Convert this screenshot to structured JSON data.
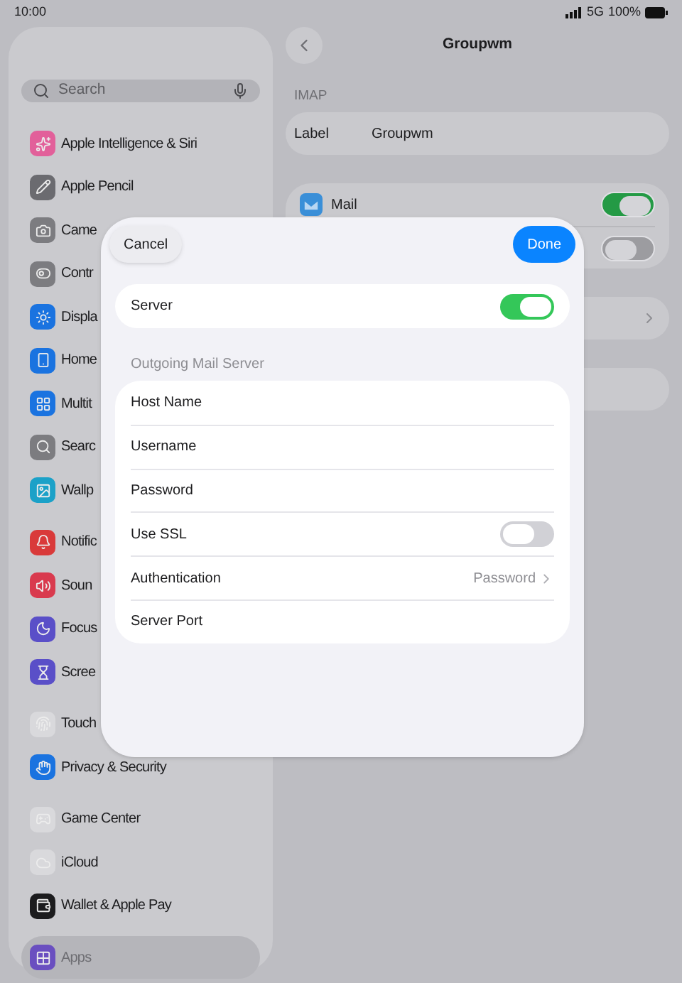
{
  "status_bar": {
    "time": "10:00",
    "network": "5G",
    "battery": "100%"
  },
  "sidebar": {
    "search": {
      "placeholder": "Search"
    },
    "groups": [
      [
        {
          "label": "Apple Intelligence & Siri",
          "color": "#e2609a",
          "selected": false
        },
        {
          "label": "Apple Pencil",
          "color": "#6b6b70",
          "selected": false
        },
        {
          "label": "Came",
          "color": "#7c7c80",
          "selected": false
        },
        {
          "label": "Contr",
          "color": "#7c7c80",
          "selected": false
        },
        {
          "label": "Displa",
          "color": "#1a73e0",
          "selected": false
        },
        {
          "label": "Home",
          "color": "#1a73e0",
          "selected": false
        },
        {
          "label": "Multit",
          "color": "#1a73e0",
          "selected": false
        },
        {
          "label": "Searc",
          "color": "#7c7c80",
          "selected": false
        },
        {
          "label": "Wallp",
          "color": "#1ba1c8",
          "selected": false
        }
      ],
      [
        {
          "label": "Notific",
          "color": "#d93a3a",
          "selected": false
        },
        {
          "label": "Soun",
          "color": "#d93a4e",
          "selected": false
        },
        {
          "label": "Focus",
          "color": "#5a4fc8",
          "selected": false
        },
        {
          "label": "Scree",
          "color": "#5a4fc8",
          "selected": false
        }
      ],
      [
        {
          "label": "Touch",
          "color": "#d9d9dc",
          "selected": false
        },
        {
          "label": "Privacy & Security",
          "color": "#1a73e0",
          "selected": false
        }
      ],
      [
        {
          "label": "Game Center",
          "color": "#d9d9dc",
          "selected": false
        },
        {
          "label": "iCloud",
          "color": "#d9d9dc",
          "selected": false
        },
        {
          "label": "Wallet & Apple Pay",
          "color": "#1c1c1e",
          "selected": false
        }
      ],
      [
        {
          "label": "Apps",
          "color": "#6a4fc0",
          "selected": true
        }
      ]
    ]
  },
  "detail": {
    "title": "Groupwm",
    "section": "IMAP",
    "label_row": {
      "label": "Label",
      "value": "Groupwm"
    },
    "account_rows": [
      {
        "label": "Mail",
        "on": true
      },
      {
        "on": false
      }
    ]
  },
  "sheet": {
    "cancel": "Cancel",
    "done": "Done",
    "server": {
      "label": "Server",
      "on": true
    },
    "section": "Outgoing Mail Server",
    "rows": [
      {
        "kind": "field",
        "label": "Host Name"
      },
      {
        "kind": "field",
        "label": "Username"
      },
      {
        "kind": "field",
        "label": "Password"
      },
      {
        "kind": "toggle",
        "label": "Use SSL",
        "on": false
      },
      {
        "kind": "link",
        "label": "Authentication",
        "value": "Password"
      },
      {
        "kind": "field",
        "label": "Server Port"
      }
    ]
  }
}
